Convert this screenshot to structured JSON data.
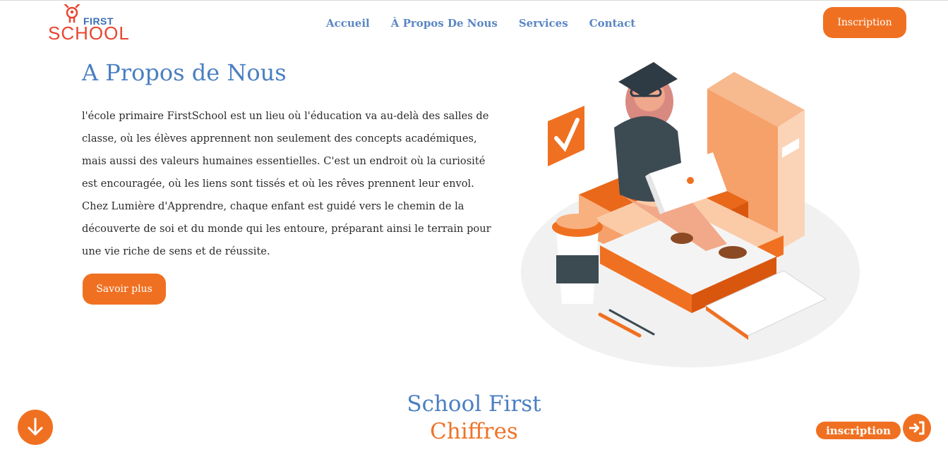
{
  "logo": {
    "first": "FIRST",
    "school": "SCHOOL"
  },
  "nav": [
    "Accueil",
    "À Propos De Nous",
    "Services",
    "Contact"
  ],
  "header": {
    "signup_label": "Inscription"
  },
  "about": {
    "title": "A Propos de Nous",
    "text": "l'école primaire FirstSchool est un lieu où l'éducation va au-delà des salles de classe, où les élèves apprennent non seulement des concepts académiques, mais aussi des valeurs humaines essentielles. C'est un endroit où la curiosité est encouragée, où les liens sont tissés et où les rêves prennent leur envol. Chez Lumière d'Apprendre, chaque enfant est guidé vers le chemin de la découverte de soi et du monde qui les entoure, préparant ainsi le terrain pour une vie riche de sens et de réussite.",
    "button": "Savoir plus"
  },
  "stats": {
    "title": "School First",
    "subtitle": "Chiffres"
  },
  "floating": {
    "signup_label": "inscription"
  },
  "colors": {
    "orange": "#f07021",
    "blue": "#4a7fc1"
  }
}
